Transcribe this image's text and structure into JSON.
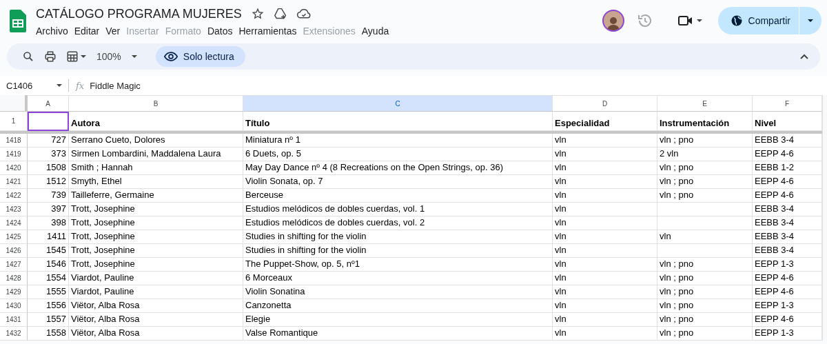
{
  "document": {
    "title": "CATÁLOGO PROGRAMA MUJERES"
  },
  "menu": [
    {
      "label": "Archivo",
      "disabled": false
    },
    {
      "label": "Editar",
      "disabled": false
    },
    {
      "label": "Ver",
      "disabled": false
    },
    {
      "label": "Insertar",
      "disabled": true
    },
    {
      "label": "Formato",
      "disabled": true
    },
    {
      "label": "Datos",
      "disabled": false
    },
    {
      "label": "Herramientas",
      "disabled": false
    },
    {
      "label": "Extensiones",
      "disabled": true
    },
    {
      "label": "Ayuda",
      "disabled": false
    }
  ],
  "share_button": {
    "label": "Compartir"
  },
  "toolbar": {
    "zoom": "100%",
    "mode_chip": "Solo lectura"
  },
  "formula_bar": {
    "cell_ref": "C1406",
    "fx": "fx",
    "value": "Fiddle Magic"
  },
  "sheet": {
    "columns": [
      {
        "letter": "A",
        "selected": false
      },
      {
        "letter": "B",
        "selected": false
      },
      {
        "letter": "C",
        "selected": true
      },
      {
        "letter": "D",
        "selected": false
      },
      {
        "letter": "E",
        "selected": false
      },
      {
        "letter": "F",
        "selected": false
      }
    ],
    "header_row": {
      "number": "1",
      "cells": [
        "",
        "Autora",
        "Título",
        "Especialidad",
        "Instrumentación",
        "Nivel"
      ]
    },
    "rows": [
      {
        "number": "1418",
        "cells": [
          "727",
          "Serrano Cueto, Dolores",
          "Miniatura nº 1",
          "vln",
          "vln ; pno",
          "EEBB 3-4"
        ]
      },
      {
        "number": "1419",
        "cells": [
          "373",
          "Sirmen Lombardini, Maddalena Laura",
          "6 Duets, op. 5",
          "vln",
          "2 vln",
          "EEPP 4-6"
        ]
      },
      {
        "number": "1420",
        "cells": [
          "1508",
          "Smith ; Hannah",
          "May Day Dance nº 4 (8 Recreations on the Open Strings, op. 36)",
          "vln",
          "vln ; pno",
          "EEBB 1-2"
        ]
      },
      {
        "number": "1421",
        "cells": [
          "1512",
          "Smyth, Ethel",
          "Violin Sonata, op. 7",
          "vln",
          "vln ; pno",
          "EEPP 4-6"
        ]
      },
      {
        "number": "1422",
        "cells": [
          "739",
          "Tailleferre, Germaine",
          "Berceuse",
          "vln",
          "vln ; pno",
          "EEPP 4-6"
        ]
      },
      {
        "number": "1423",
        "cells": [
          "397",
          "Trott, Josephine",
          "Estudios melódicos de dobles cuerdas, vol. 1",
          "vln",
          "",
          "EEBB 3-4"
        ]
      },
      {
        "number": "1424",
        "cells": [
          "398",
          "Trott, Josephine",
          "Estudios melódicos de dobles cuerdas, vol. 2",
          "vln",
          "",
          "EEBB 3-4"
        ]
      },
      {
        "number": "1425",
        "cells": [
          "1411",
          "Trott, Josephine",
          "Studies in shifting for the violin",
          "vln",
          "vln",
          "EEBB 3-4"
        ]
      },
      {
        "number": "1426",
        "cells": [
          "1545",
          "Trott, Josephine",
          "Studies in shifting for the violin",
          "vln",
          "",
          "EEBB 3-4"
        ]
      },
      {
        "number": "1427",
        "cells": [
          "1546",
          "Trott, Josephine",
          "The Puppet-Show, op. 5, nº1",
          "vln",
          "vln ; pno",
          "EEPP 1-3"
        ]
      },
      {
        "number": "1428",
        "cells": [
          "1554",
          "Viardot, Pauline",
          "6 Morceaux",
          "vln",
          "vln ; pno",
          "EEPP 4-6"
        ]
      },
      {
        "number": "1429",
        "cells": [
          "1555",
          "Viardot, Pauline",
          "Violin Sonatina",
          "vln",
          "vln ; pno",
          "EEPP 4-6"
        ]
      },
      {
        "number": "1430",
        "cells": [
          "1556",
          "Viëtor, Alba Rosa",
          "Canzonetta",
          "vln",
          "vln ; pno",
          "EEPP 1-3"
        ]
      },
      {
        "number": "1431",
        "cells": [
          "1557",
          "Viëtor, Alba Rosa",
          "Elegie",
          "vln",
          "vln ; pno",
          "EEPP 4-6"
        ]
      },
      {
        "number": "1432",
        "cells": [
          "1558",
          "Viëtor, Alba Rosa",
          "Valse Romantique",
          "vln",
          "vln ; pno",
          "EEPP 1-3"
        ]
      }
    ]
  }
}
